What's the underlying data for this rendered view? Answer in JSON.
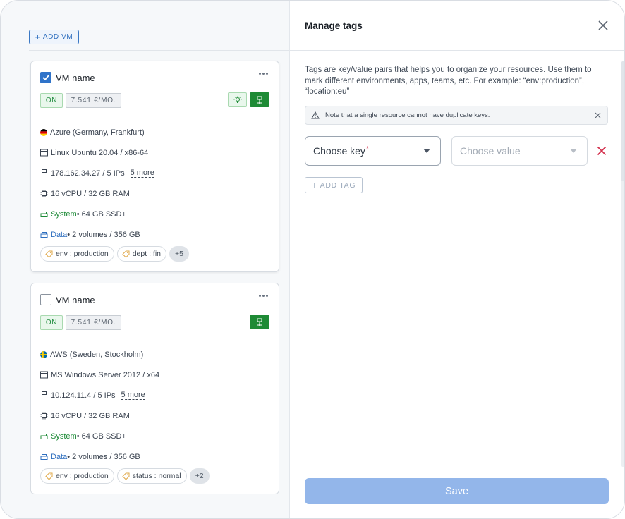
{
  "left": {
    "add_vm_label": "ADD VM",
    "cards": [
      {
        "name": "VM name",
        "checked": true,
        "status": "ON",
        "price": "7.541 €/MO.",
        "location": "Azure (Germany, Frankfurt)",
        "os": "Linux Ubuntu 20.04 / x86-64",
        "ip": "178.162.34.27 / 5 IPs",
        "ip_more": "5 more",
        "cpu": "16 vCPU / 32 GB RAM",
        "system_label": "System",
        "system_value": " • 64 GB SSD+",
        "data_label": "Data",
        "data_value": " • 2 volumes / 356 GB",
        "tags": [
          "env : production",
          "dept : fin"
        ],
        "tags_more": "+5"
      },
      {
        "name": "VM name",
        "checked": false,
        "status": "ON",
        "price": "7.541 €/MO.",
        "location": "AWS (Sweden, Stockholm)",
        "os": "MS Windows Server 2012 / x64",
        "ip": "10.124.11.4 / 5 IPs",
        "ip_more": "5 more",
        "cpu": "16 vCPU / 32 GB RAM",
        "system_label": "System",
        "system_value": " • 64 GB SSD+",
        "data_label": "Data",
        "data_value": " • 2 volumes / 356 GB",
        "tags": [
          "env : production",
          "status : normal"
        ],
        "tags_more": "+2"
      }
    ]
  },
  "modal": {
    "title": "Manage tags",
    "description": "Tags are key/value pairs that helps you to organize your resources. Use them to mark different environments, apps, teams, etc. For example: “env:production”, “location:eu”",
    "note": "Note that a single resource cannot have duplicate keys.",
    "key_placeholder": "Choose key",
    "key_required_mark": "*",
    "value_placeholder": "Choose value",
    "add_tag_label": "ADD TAG",
    "save_label": "Save"
  },
  "colors": {
    "accent": "#2f73c9",
    "success": "#1e8a35",
    "danger": "#d3304d",
    "save_disabled": "#93b6ea"
  }
}
